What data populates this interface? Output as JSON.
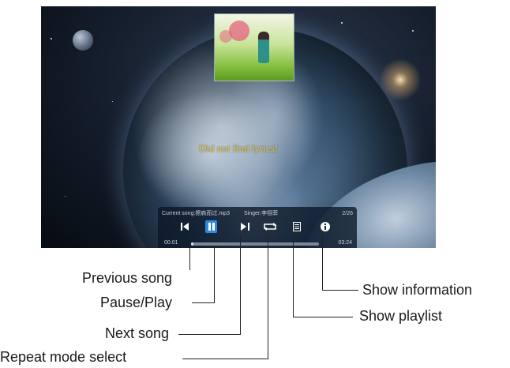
{
  "player": {
    "current_song": "Current song:擦肩而过.mp3",
    "singer": "Singer:李栩菲",
    "track_count": "2/26",
    "current_time": "00:01",
    "total_time": "03:24",
    "progress": 0.01
  },
  "lyrics": {
    "text": "Did not find lyrics!"
  },
  "controls": {
    "previous": "previous-icon",
    "pause_play": "pause-icon",
    "next": "next-icon",
    "repeat": "repeat-icon",
    "playlist": "playlist-icon",
    "info": "info-icon",
    "accent_color": "#2a8be0"
  },
  "callouts": {
    "previous_song": "Previous song",
    "pause_play": "Pause/Play",
    "next_song": "Next song",
    "repeat_mode": "Repeat mode select",
    "show_information": "Show information",
    "show_playlist": "Show playlist"
  }
}
